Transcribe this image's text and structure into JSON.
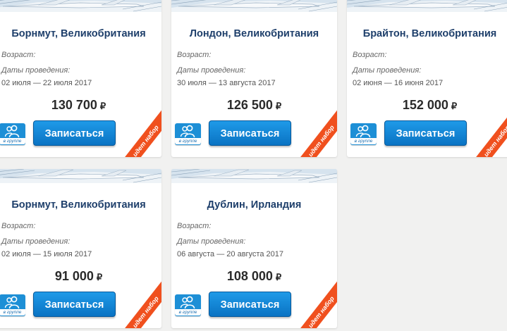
{
  "labels": {
    "age": "Возраст:",
    "dates": "Даты проведения:",
    "signup": "Записаться",
    "group": "в группе",
    "recruiting": "идет набор",
    "currency": "₽"
  },
  "colors": {
    "title": "#1e3f6b",
    "button": "#0a73c3",
    "ribbon": "#f0501e",
    "badge": "#1d8fd6"
  },
  "tours": [
    {
      "title": "Борнмут, Великобритания",
      "dates": "02 июля — 22 июля 2017",
      "price": "130 700"
    },
    {
      "title": "Лондон, Великобритания",
      "dates": "30 июля — 13 августа 2017",
      "price": "126 500"
    },
    {
      "title": "Брайтон, Великобритания",
      "dates": "02 июня — 16 июня 2017",
      "price": "152 000"
    },
    {
      "title": "Борнмут, Великобритания",
      "dates": "02 июля — 15 июля 2017",
      "price": "91 000"
    },
    {
      "title": "Дублин, Ирландия",
      "dates": "06 августа — 20 августа 2017",
      "price": "108 000"
    }
  ]
}
